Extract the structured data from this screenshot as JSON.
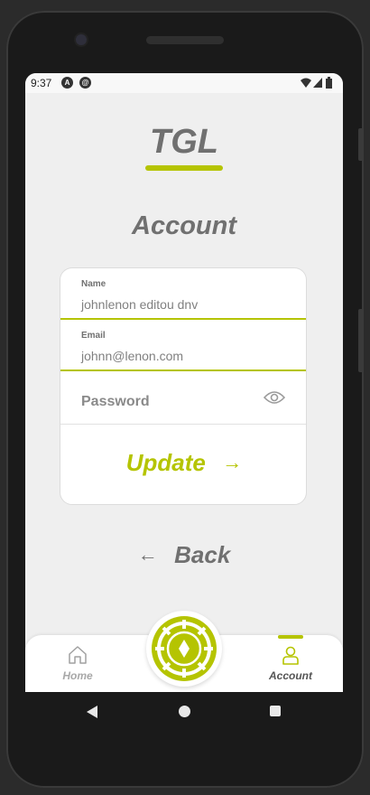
{
  "status": {
    "time": "9:37"
  },
  "app": {
    "logo": "TGL"
  },
  "page": {
    "title": "Account"
  },
  "form": {
    "name": {
      "label": "Name",
      "value": "johnlenon editou dnv"
    },
    "email": {
      "label": "Email",
      "value": "johnn@lenon.com"
    },
    "password": {
      "placeholder": "Password"
    },
    "update_label": "Update"
  },
  "back_label": "Back",
  "nav": {
    "home_label": "Home",
    "account_label": "Account",
    "active": "account"
  },
  "colors": {
    "accent": "#b5c401",
    "text": "#707070",
    "background": "#efefef"
  },
  "icons": [
    "eye-icon",
    "arrow-right-icon",
    "arrow-left-icon",
    "home-icon",
    "user-icon",
    "game-chip-icon"
  ]
}
